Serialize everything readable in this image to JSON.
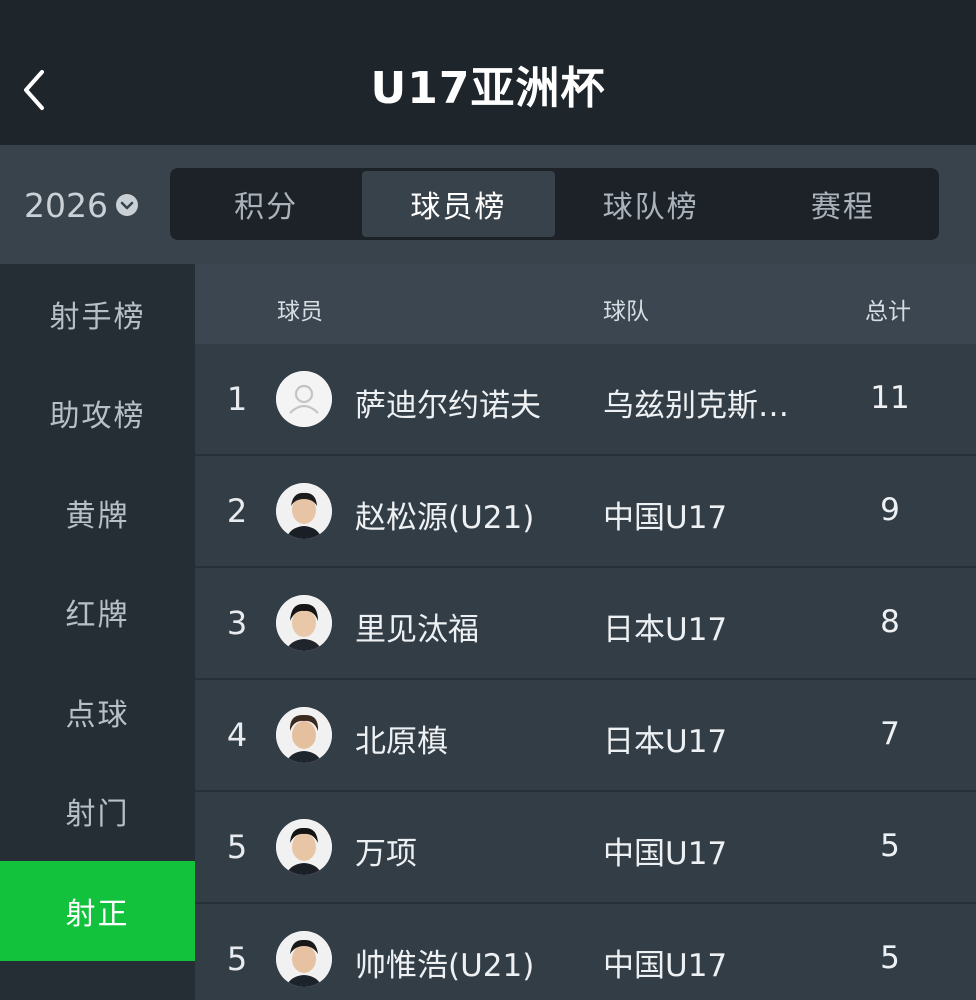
{
  "header": {
    "title": "U17亚洲杯"
  },
  "season": {
    "value": "2026"
  },
  "tabs": [
    {
      "label": "积分"
    },
    {
      "label": "球员榜"
    },
    {
      "label": "球队榜"
    },
    {
      "label": "赛程"
    }
  ],
  "sidebar": {
    "items": [
      {
        "label": "射手榜"
      },
      {
        "label": "助攻榜"
      },
      {
        "label": "黄牌"
      },
      {
        "label": "红牌"
      },
      {
        "label": "点球"
      },
      {
        "label": "射门"
      },
      {
        "label": "射正"
      }
    ]
  },
  "table": {
    "headers": {
      "player": "球员",
      "team": "球队",
      "total": "总计"
    },
    "rows": [
      {
        "rank": "1",
        "name": "萨迪尔约诺夫",
        "team": "乌兹别克斯…",
        "total": "11",
        "avatar": "placeholder"
      },
      {
        "rank": "2",
        "name": "赵松源(U21)",
        "team": "中国U17",
        "total": "9",
        "avatar": "photo"
      },
      {
        "rank": "3",
        "name": "里见汰福",
        "team": "日本U17",
        "total": "8",
        "avatar": "photo"
      },
      {
        "rank": "4",
        "name": "北原槙",
        "team": "日本U17",
        "total": "7",
        "avatar": "photo"
      },
      {
        "rank": "5",
        "name": "万项",
        "team": "中国U17",
        "total": "5",
        "avatar": "photo"
      },
      {
        "rank": "5",
        "name": "帅惟浩(U21)",
        "team": "中国U17",
        "total": "5",
        "avatar": "photo"
      }
    ]
  },
  "colors": {
    "header_bg": "#1e252b",
    "active_side": "#12c23d",
    "table_bg": "#333d46"
  }
}
